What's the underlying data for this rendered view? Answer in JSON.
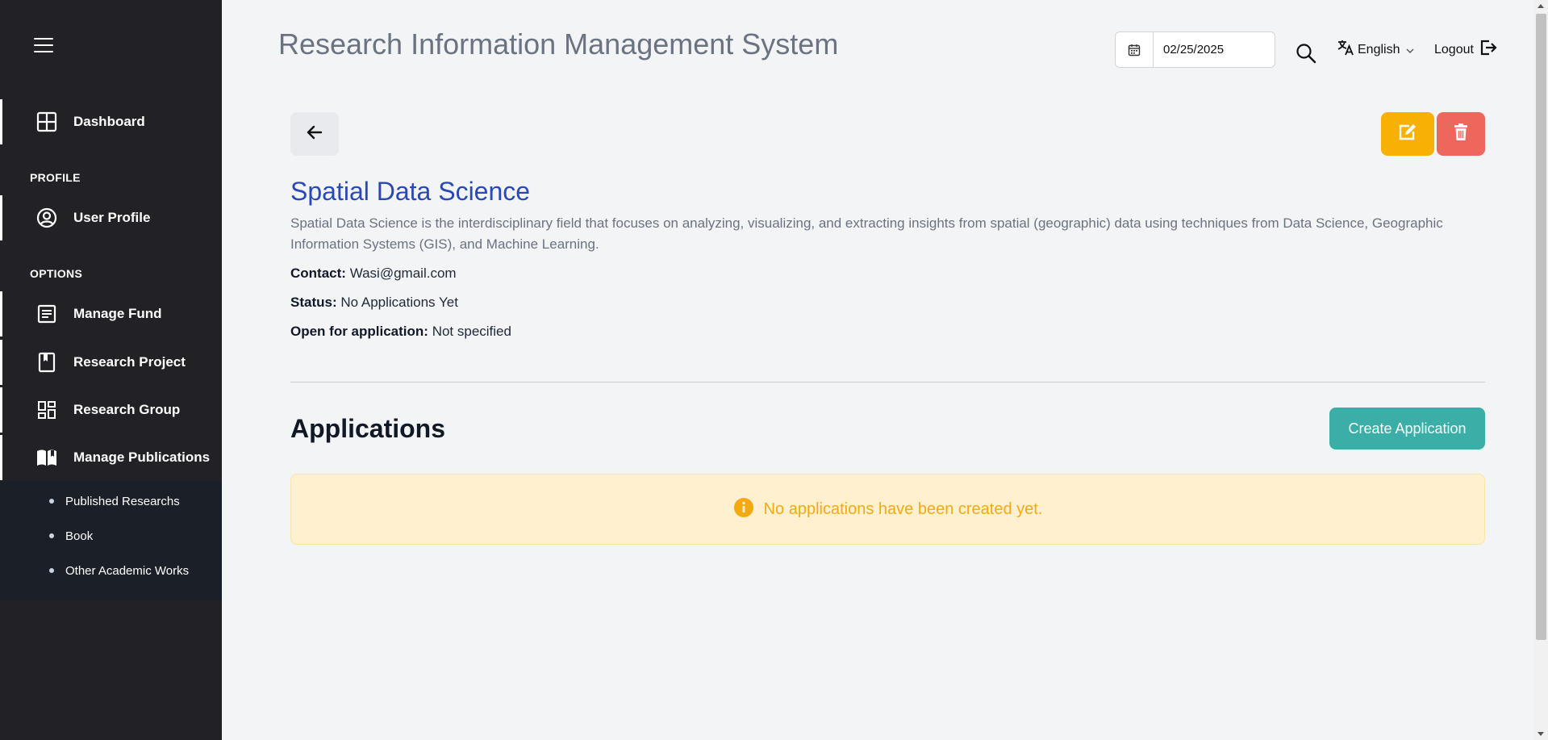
{
  "header": {
    "title": "Research Information Management System",
    "date_value": "02/25/2025",
    "language": "English",
    "logout_label": "Logout"
  },
  "sidebar": {
    "dashboard": "Dashboard",
    "profile_section": "PROFILE",
    "user_profile": "User Profile",
    "options_section": "OPTIONS",
    "items": [
      {
        "label": "Manage Fund",
        "icon": "document-list-icon"
      },
      {
        "label": "Research Project",
        "icon": "bookmark-book-icon"
      },
      {
        "label": "Research Group",
        "icon": "dashboard-grid-icon"
      },
      {
        "label": "Manage Publications",
        "icon": "open-book-icon"
      }
    ],
    "submenu": [
      {
        "label": "Published Researchs"
      },
      {
        "label": "Book"
      },
      {
        "label": "Other Academic Works"
      }
    ]
  },
  "fund": {
    "title": "Spatial Data Science",
    "description": "Spatial Data Science is the interdisciplinary field that focuses on analyzing, visualizing, and extracting insights from spatial (geographic) data using techniques from Data Science, Geographic Information Systems (GIS), and Machine Learning.",
    "contact_label": "Contact:",
    "contact_value": "Wasi@gmail.com",
    "status_label": "Status:",
    "status_value": "No Applications Yet",
    "open_label": "Open for application:",
    "open_value": "Not specified"
  },
  "applications": {
    "title": "Applications",
    "create_label": "Create Application",
    "empty_message": "No applications have been created yet."
  },
  "colors": {
    "sidebar_bg": "#222226",
    "title_blue": "#2a49b5",
    "edit_yellow": "#f8b004",
    "delete_red": "#ef665c",
    "create_teal": "#3aaea7",
    "alert_bg": "#fff1cf",
    "alert_text": "#f4a912"
  }
}
